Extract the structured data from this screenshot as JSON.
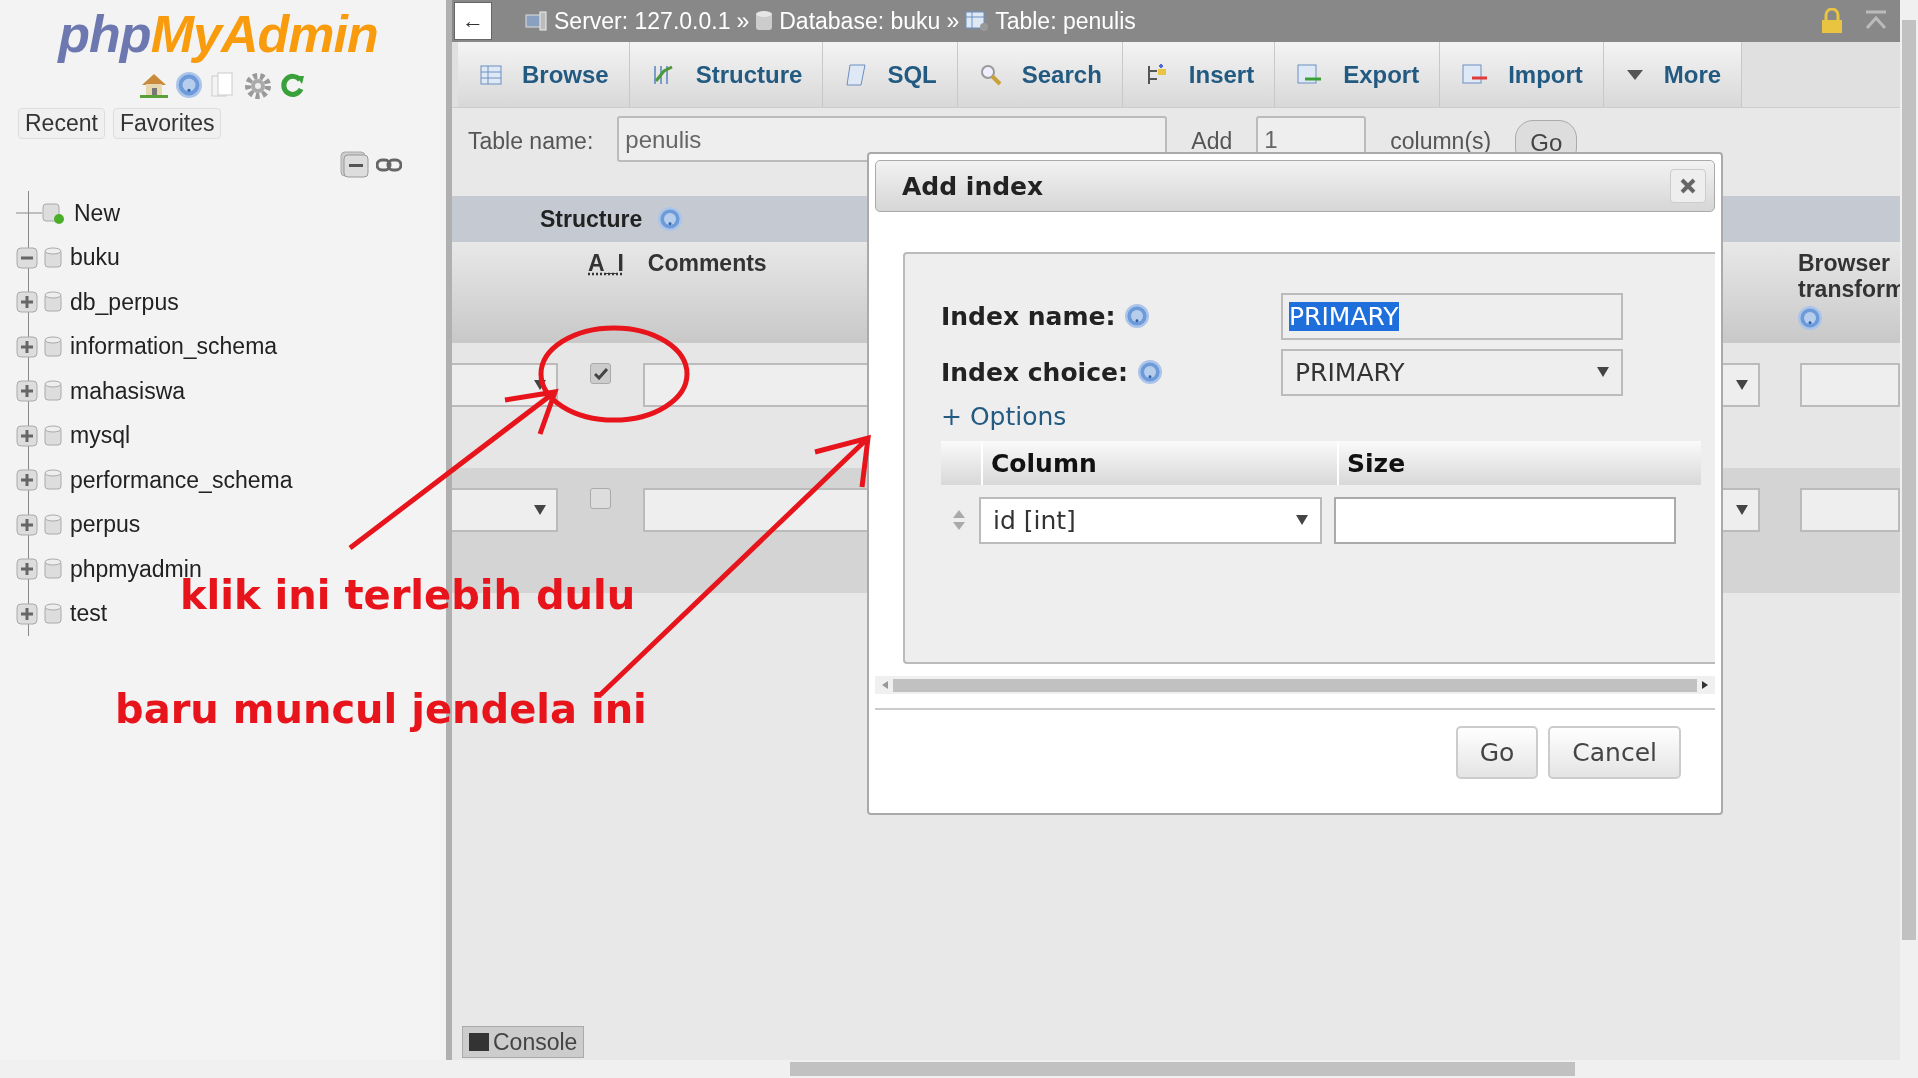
{
  "sidebar": {
    "logo": {
      "part_1": "php",
      "part_2": "MyAdmin"
    },
    "tabs": [
      {
        "label": "Recent"
      },
      {
        "label": "Favorites"
      }
    ],
    "tree": [
      {
        "label": "New",
        "kind": "new"
      },
      {
        "label": "buku",
        "kind": "db",
        "expanded": true
      },
      {
        "label": "db_perpus",
        "kind": "db",
        "expanded": false
      },
      {
        "label": "information_schema",
        "kind": "db",
        "expanded": false
      },
      {
        "label": "mahasiswa",
        "kind": "db",
        "expanded": false
      },
      {
        "label": "mysql",
        "kind": "db",
        "expanded": false
      },
      {
        "label": "performance_schema",
        "kind": "db",
        "expanded": false
      },
      {
        "label": "perpus",
        "kind": "db",
        "expanded": false
      },
      {
        "label": "phpmyadmin",
        "kind": "db",
        "expanded": false
      },
      {
        "label": "test",
        "kind": "db",
        "expanded": false
      }
    ]
  },
  "breadcrumb": {
    "back": "←",
    "separator": "»",
    "items": [
      {
        "label": "Server: 127.0.0.1",
        "kind": "server"
      },
      {
        "label": "Database: buku",
        "kind": "database"
      },
      {
        "label": "Table: penulis",
        "kind": "table"
      }
    ]
  },
  "tabs": [
    {
      "label": "Browse",
      "kind": "browse"
    },
    {
      "label": "Structure",
      "kind": "structure"
    },
    {
      "label": "SQL",
      "kind": "sql"
    },
    {
      "label": "Search",
      "kind": "search"
    },
    {
      "label": "Insert",
      "kind": "insert"
    },
    {
      "label": "Export",
      "kind": "export"
    },
    {
      "label": "Import",
      "kind": "import"
    },
    {
      "label": "More",
      "kind": "more"
    }
  ],
  "form": {
    "table_name_label": "Table name:",
    "table_name": "penulis",
    "add_label": "Add",
    "add_count": "1",
    "columns_label": "column(s)",
    "go": "Go"
  },
  "structure": {
    "title": "Structure",
    "headers": [
      "A_I",
      "Comments"
    ],
    "right_header": [
      "Browser",
      "transform"
    ],
    "rows": [
      {
        "ai_checked": true
      },
      {
        "ai_checked": false
      }
    ]
  },
  "dialog": {
    "title": "Add index",
    "index_name_label": "Index name:",
    "index_name": "PRIMARY",
    "index_name_highlighted": true,
    "index_choice_label": "Index choice:",
    "index_choice": "PRIMARY",
    "options_link": "+ Options",
    "columns": [
      "Column",
      "Size"
    ],
    "rows": [
      {
        "column": "id [int]"
      }
    ],
    "buttons": [
      "Go",
      "Cancel"
    ]
  },
  "console": "Console",
  "annotations": [
    "klik ini terlebih dulu",
    "baru muncul jendela ini"
  ]
}
